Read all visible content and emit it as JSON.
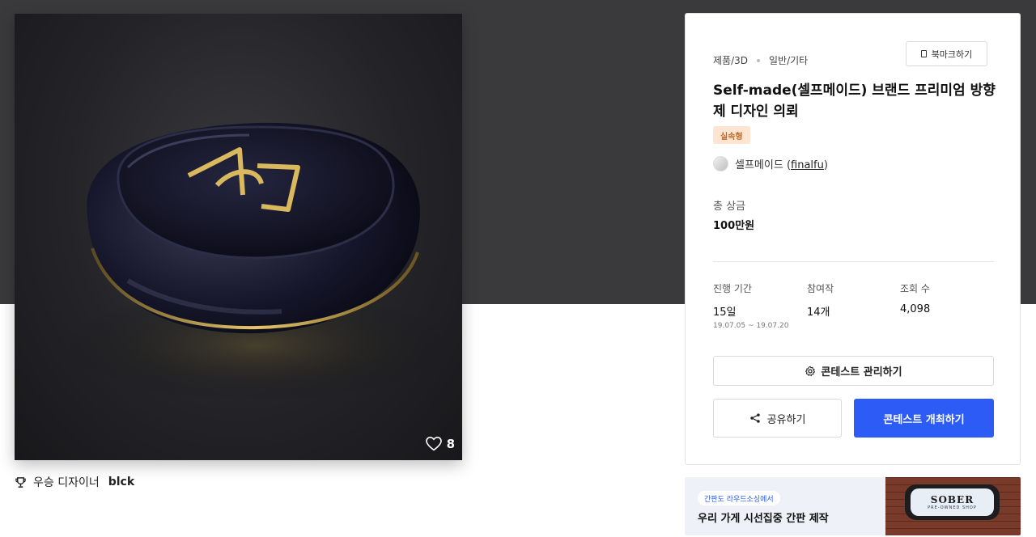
{
  "product": {
    "like_count": "8",
    "winner_label": "우승 디자이너",
    "winner_name": "blck"
  },
  "info": {
    "category_main": "제품/3D",
    "category_sub": "일반/기타",
    "bookmark_label": "북마크하기",
    "title": "Self-made(셀프메이드) 브랜드 프리미엄 방향제 디자인 의뢰",
    "badge": "실속형",
    "host_name": "셀프메이드",
    "host_id": "finalfu",
    "prize_label": "총 상금",
    "prize_value": "100만원",
    "stats": [
      {
        "label": "진행 기간",
        "value": "15일",
        "sub": "19.07.05 ~ 19.07.20"
      },
      {
        "label": "참여작",
        "value": "14개",
        "sub": ""
      },
      {
        "label": "조회 수",
        "value": "4,098",
        "sub": ""
      }
    ],
    "manage_label": "콘테스트 관리하기",
    "share_label": "공유하기",
    "host_button_label": "콘테스트 개최하기"
  },
  "ad": {
    "chip": "간판도 라우드소싱에서",
    "text": "우리 가게 시선집중 간판 제작",
    "sign_text": "SOBER",
    "sign_sub": "PRE-OWNED SHOP"
  },
  "colors": {
    "hero_background": "#3a3a3c",
    "primary_button": "#2d5bf5",
    "badge_bg": "#fde5d2",
    "badge_text": "#c06a2a"
  },
  "icons": [
    "heart-icon",
    "trophy-icon",
    "bookmark-icon",
    "gear-icon",
    "share-icon"
  ]
}
